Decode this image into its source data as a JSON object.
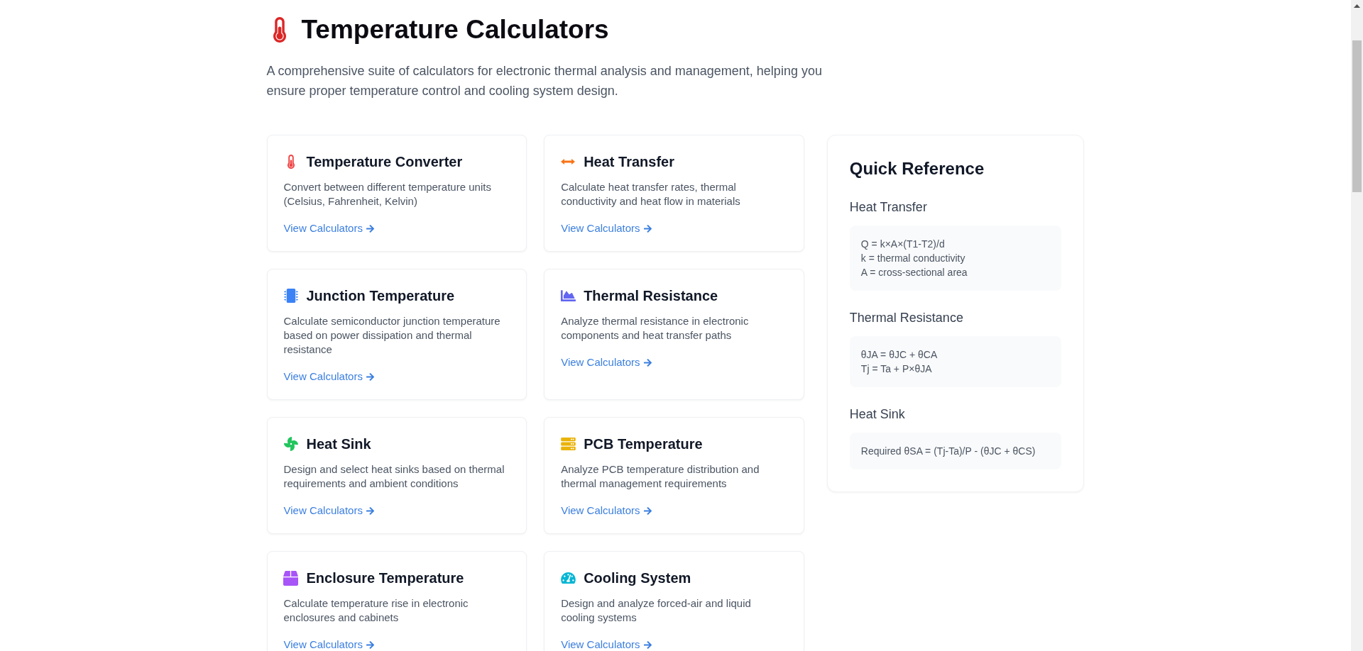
{
  "page": {
    "title": "Temperature Calculators",
    "description": "A comprehensive suite of calculators for electronic thermal analysis and management, helping you ensure proper temperature control and cooling system design."
  },
  "calculators": [
    {
      "kind": "thermometer",
      "color": "#ef4444",
      "title": "Temperature Converter",
      "description": "Convert between different temperature units (Celsius, Fahrenheit, Kelvin)",
      "link": "View Calculators"
    },
    {
      "kind": "arrows",
      "color": "#f97316",
      "title": "Heat Transfer",
      "description": "Calculate heat transfer rates, thermal conductivity and heat flow in materials",
      "link": "View Calculators"
    },
    {
      "kind": "chip",
      "color": "#3b82f6",
      "title": "Junction Temperature",
      "description": "Calculate semiconductor junction temperature based on power dissipation and thermal resistance",
      "link": "View Calculators"
    },
    {
      "kind": "chart",
      "color": "#6366f1",
      "title": "Thermal Resistance",
      "description": "Analyze thermal resistance in electronic components and heat transfer paths",
      "link": "View Calculators"
    },
    {
      "kind": "fan",
      "color": "#22c55e",
      "title": "Heat Sink",
      "description": "Design and select heat sinks based on thermal requirements and ambient conditions",
      "link": "View Calculators"
    },
    {
      "kind": "server",
      "color": "#eab308",
      "title": "PCB Temperature",
      "description": "Analyze PCB temperature distribution and thermal management requirements",
      "link": "View Calculators"
    },
    {
      "kind": "box",
      "color": "#a855f7",
      "title": "Enclosure Temperature",
      "description": "Calculate temperature rise in electronic enclosures and cabinets",
      "link": "View Calculators"
    },
    {
      "kind": "gauge",
      "color": "#06b6d4",
      "title": "Cooling System",
      "description": "Design and analyze forced-air and liquid cooling systems",
      "link": "View Calculators"
    }
  ],
  "quick_reference": {
    "title": "Quick Reference",
    "sections": [
      {
        "heading": "Heat Transfer",
        "lines": [
          "Q = k×A×(T1-T2)/d",
          "k = thermal conductivity",
          "A = cross-sectional area"
        ]
      },
      {
        "heading": "Thermal Resistance",
        "lines": [
          "θJA = θJC + θCA",
          "Tj = Ta + P×θJA"
        ]
      },
      {
        "heading": "Heat Sink",
        "lines": [
          "Required θSA = (Tj-Ta)/P - (θJC + θCS)"
        ]
      }
    ]
  }
}
